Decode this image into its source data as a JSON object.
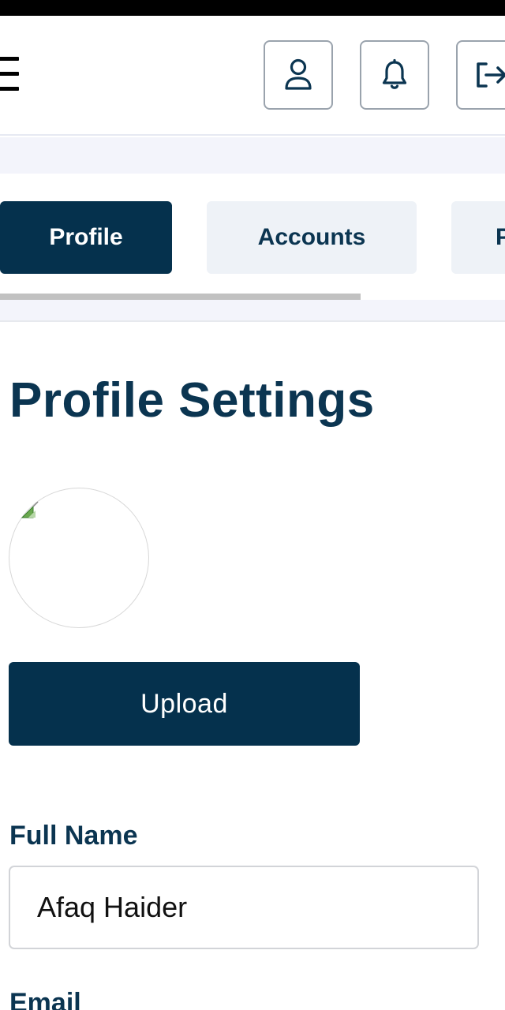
{
  "header": {
    "menu_icon": "hamburger-menu-icon",
    "actions": [
      {
        "name": "profile",
        "icon": "user-icon"
      },
      {
        "name": "notifications",
        "icon": "bell-icon"
      },
      {
        "name": "logout",
        "icon": "logout-icon"
      }
    ]
  },
  "tabs": [
    {
      "label": "Profile",
      "active": true
    },
    {
      "label": "Accounts",
      "active": false
    },
    {
      "label": "P",
      "active": false
    }
  ],
  "main": {
    "title": "Profile Settings",
    "avatar": {
      "icon": "broken-image-icon"
    },
    "upload_label": "Upload",
    "full_name": {
      "label": "Full Name",
      "value": "Afaq Haider"
    },
    "email": {
      "label": "Email"
    }
  },
  "colors": {
    "primary": "#05314d",
    "text": "#0b3551",
    "tab_inactive_bg": "#eef2f7",
    "band_bg": "#f3f4fb",
    "border": "#9aa3ad"
  }
}
